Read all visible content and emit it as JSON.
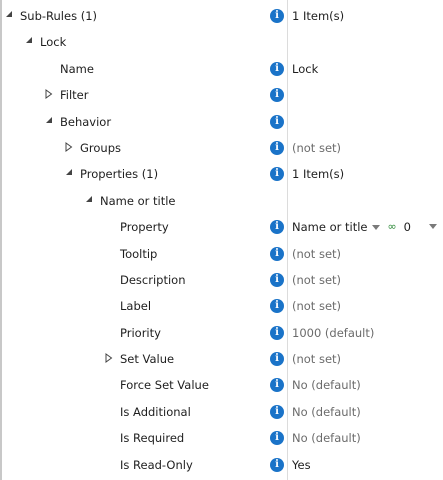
{
  "rows": [
    {
      "label": "Sub-Rules (1)",
      "value": "1 Item(s)"
    },
    {
      "label": "Lock",
      "value": ""
    },
    {
      "label": "Name",
      "value": "Lock"
    },
    {
      "label": "Filter",
      "value": ""
    },
    {
      "label": "Behavior",
      "value": ""
    },
    {
      "label": "Groups",
      "value": "(not set)"
    },
    {
      "label": "Properties (1)",
      "value": "1 Item(s)"
    },
    {
      "label": "Name or title",
      "value": ""
    },
    {
      "label": "Property",
      "value": "Name or title",
      "extra": "0"
    },
    {
      "label": "Tooltip",
      "value": "(not set)"
    },
    {
      "label": "Description",
      "value": "(not set)"
    },
    {
      "label": "Label",
      "value": "(not set)"
    },
    {
      "label": "Priority",
      "value": "1000 (default)"
    },
    {
      "label": "Set Value",
      "value": "(not set)"
    },
    {
      "label": "Force Set Value",
      "value": "No (default)"
    },
    {
      "label": "Is Additional",
      "value": "No (default)"
    },
    {
      "label": "Is Required",
      "value": "No (default)"
    },
    {
      "label": "Is Read-Only",
      "value": "Yes"
    }
  ],
  "icons": {
    "info": "info-icon",
    "expanded": "triangle-down-icon",
    "collapsed": "triangle-right-icon",
    "link": "link-icon",
    "dropdown": "chevron-down-icon"
  },
  "colors": {
    "info_icon": "#1a73c8",
    "link_icon": "#2e8b3a",
    "muted_text": "#6b6b6b",
    "text": "#1e1e1e"
  }
}
